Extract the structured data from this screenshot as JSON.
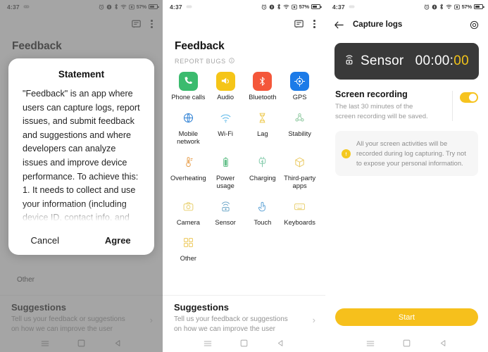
{
  "statusbar": {
    "time": "4:37",
    "battery_percent": "57%",
    "icons": [
      "alarm-icon",
      "do-not-disturb-icon",
      "bluetooth-icon",
      "wifi-icon",
      "screen-record-icon"
    ]
  },
  "panel1": {
    "page_title": "Feedback",
    "behind_label": "Other",
    "dialog": {
      "title": "Statement",
      "body": "\"Feedback\" is an app where users can capture logs, report issues, and submit feedback and suggestions and where developers can analyze issues and improve device performance. To achieve this: 1. It needs to collect and use your information (including device ID, contact info, and IP address) to identify and locate your device and to contact you. To resolve fingerprint",
      "cancel_label": "Cancel",
      "agree_label": "Agree"
    },
    "suggestions": {
      "title": "Suggestions",
      "subtitle": "Tell us your feedback or suggestions on how we can improve the user"
    }
  },
  "panel2": {
    "page_title": "Feedback",
    "section_label": "REPORT BUGS",
    "grid": [
      {
        "label": "Phone calls",
        "icon": "phone-icon",
        "style": "tile",
        "bg": "#3BBB6E",
        "fg": "#ffffff"
      },
      {
        "label": "Audio",
        "icon": "speaker-icon",
        "style": "tile",
        "bg": "#F5C518",
        "fg": "#ffffff"
      },
      {
        "label": "Bluetooth",
        "icon": "bluetooth-icon",
        "style": "tile",
        "bg": "#F4573A",
        "fg": "#ffffff"
      },
      {
        "label": "GPS",
        "icon": "gps-icon",
        "style": "tile",
        "bg": "#1C7BE8",
        "fg": "#ffffff"
      },
      {
        "label": "Mobile network",
        "icon": "globe-icon",
        "style": "flat",
        "bg": "transparent",
        "fg": "#2B7FD4"
      },
      {
        "label": "Wi-Fi",
        "icon": "wifi-icon",
        "style": "flat",
        "bg": "transparent",
        "fg": "#5BB7E8"
      },
      {
        "label": "Lag",
        "icon": "hourglass-icon",
        "style": "flat",
        "bg": "transparent",
        "fg": "#EECB55"
      },
      {
        "label": "Stability",
        "icon": "nodes-icon",
        "style": "flat",
        "bg": "transparent",
        "fg": "#8FC9A0"
      },
      {
        "label": "Overheating",
        "icon": "thermometer-icon",
        "style": "flat",
        "bg": "transparent",
        "fg": "#E8A04F"
      },
      {
        "label": "Power usage",
        "icon": "battery-icon",
        "style": "flat",
        "bg": "transparent",
        "fg": "#67C18C"
      },
      {
        "label": "Charging",
        "icon": "plug-icon",
        "style": "flat",
        "bg": "transparent",
        "fg": "#7FC9A8"
      },
      {
        "label": "Third-party apps",
        "icon": "cube-icon",
        "style": "flat",
        "bg": "transparent",
        "fg": "#EBCA63"
      },
      {
        "label": "Camera",
        "icon": "camera-icon",
        "style": "flat",
        "bg": "transparent",
        "fg": "#E8CE6A"
      },
      {
        "label": "Sensor",
        "icon": "sensor-icon",
        "style": "flat",
        "bg": "transparent",
        "fg": "#6FA8C9"
      },
      {
        "label": "Touch",
        "icon": "touch-icon",
        "style": "flat",
        "bg": "transparent",
        "fg": "#5FA4D6"
      },
      {
        "label": "Keyboards",
        "icon": "keyboard-icon",
        "style": "flat",
        "bg": "transparent",
        "fg": "#E9D071"
      },
      {
        "label": "Other",
        "icon": "grid-icon",
        "style": "flat",
        "bg": "transparent",
        "fg": "#EDC95C"
      }
    ],
    "suggestions": {
      "title": "Suggestions",
      "subtitle": "Tell us your feedback or suggestions on how we can improve the user"
    }
  },
  "panel3": {
    "appbar_title": "Capture logs",
    "sensor_card": {
      "name": "Sensor",
      "time_main": "00:00:",
      "time_accent": "00"
    },
    "recording": {
      "title": "Screen recording",
      "subtitle": "The last 30 minutes of the screen recording will be saved.",
      "toggle_on": true
    },
    "note": "All your screen activities will be recorded during log capturing. Try not to expose your personal information.",
    "start_label": "Start"
  },
  "colors": {
    "accent_yellow": "#F6C01C",
    "card_dark": "#393939",
    "timer_accent": "#F2C319"
  }
}
